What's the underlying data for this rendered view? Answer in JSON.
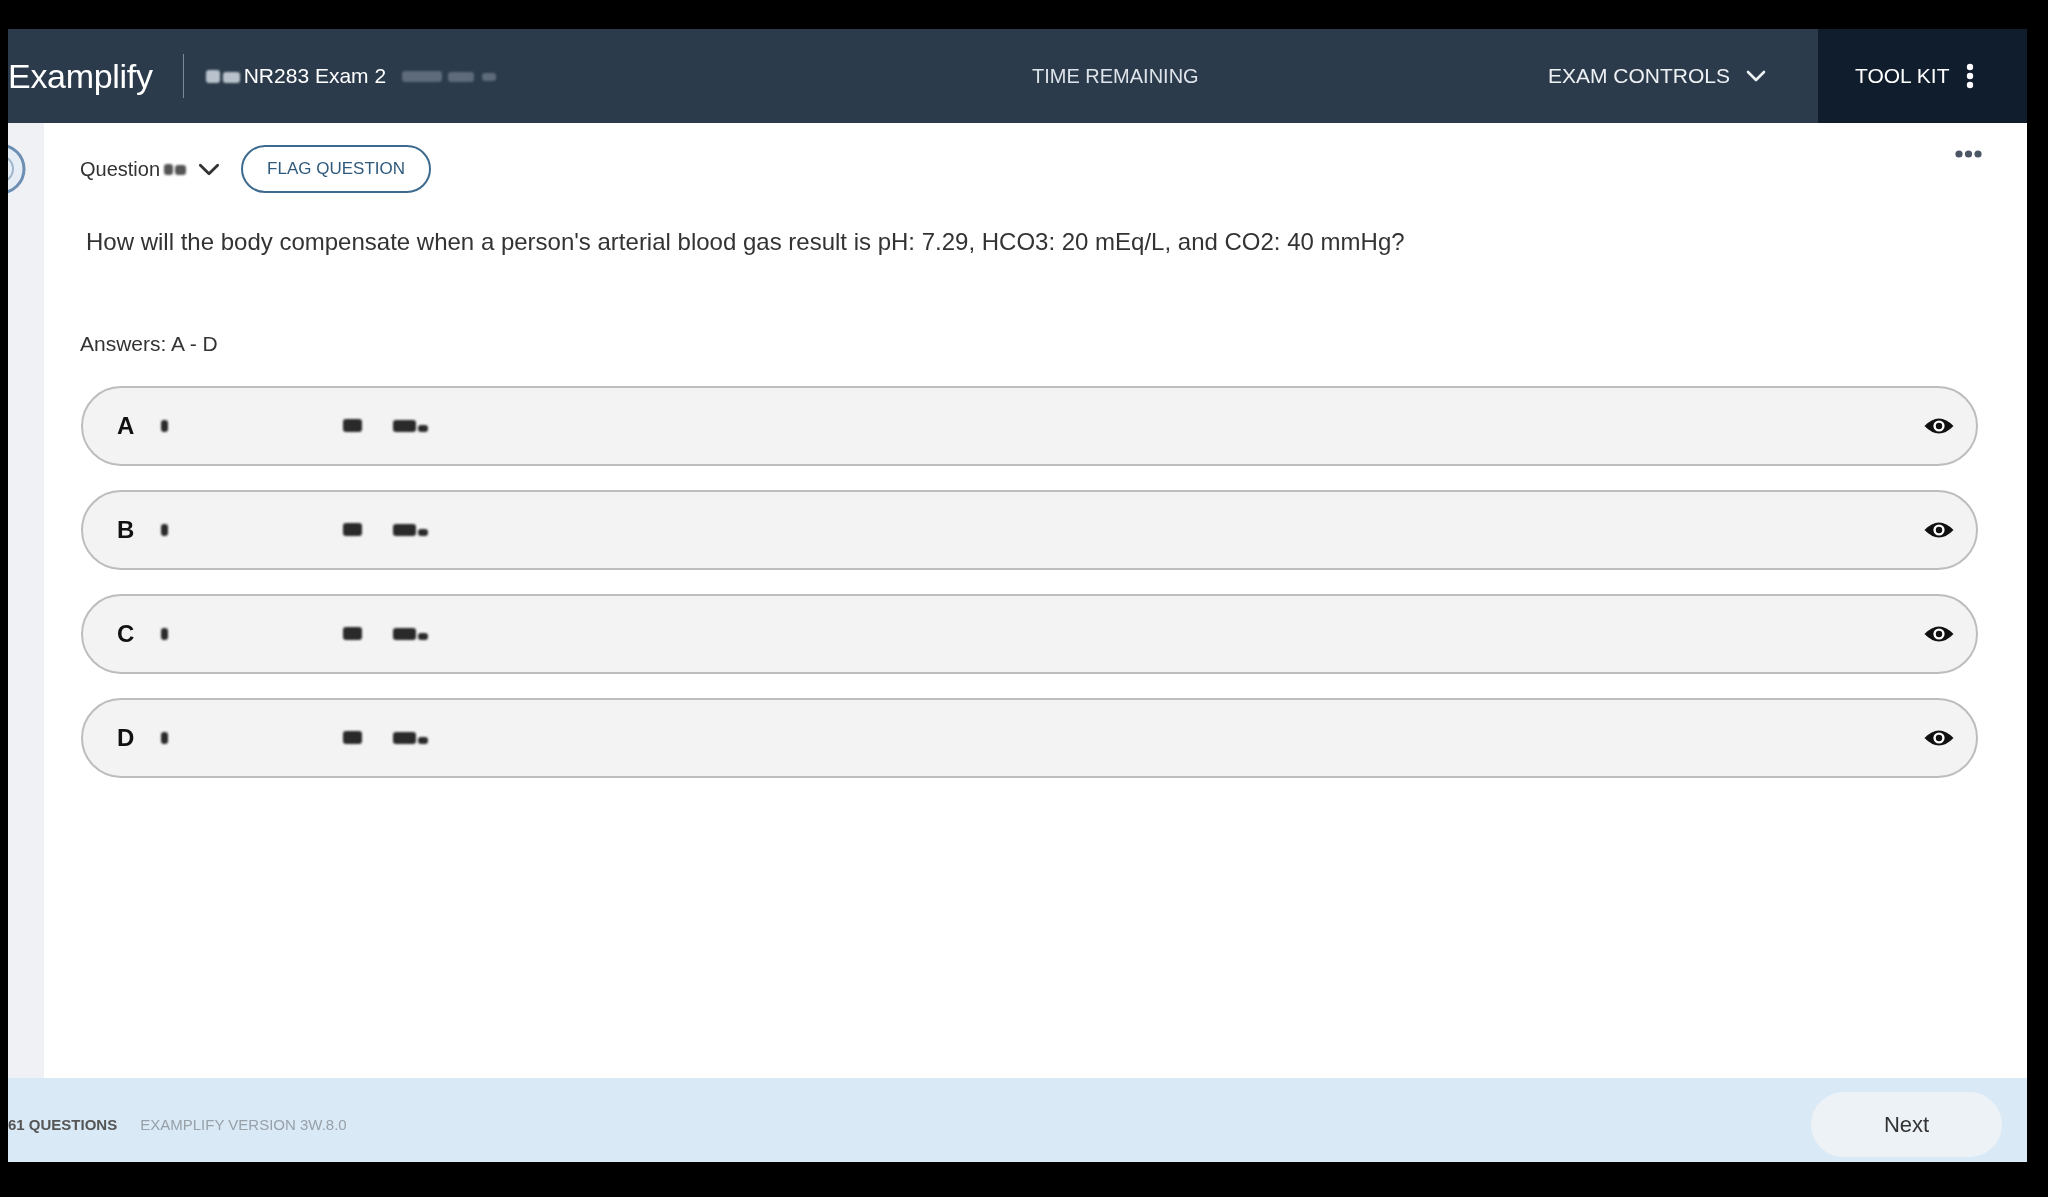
{
  "header": {
    "logo": "Examplify",
    "exam_title": "NR283 Exam 2",
    "timer_label": "TIME REMAINING",
    "exam_controls": "EXAM CONTROLS",
    "tool_kit": "TOOL KIT"
  },
  "question": {
    "label": "Question",
    "flag_button": "FLAG QUESTION",
    "text": "How will the body compensate when a person's arterial blood gas result is pH: 7.29, HCO3: 20 mEq/L, and CO2: 40 mmHg?",
    "answers_label": "Answers: A - D"
  },
  "answers": [
    {
      "letter": "A",
      "selected": false
    },
    {
      "letter": "B",
      "selected": false
    },
    {
      "letter": "C",
      "selected": false
    },
    {
      "letter": "D",
      "selected": false
    }
  ],
  "footer": {
    "question_count": "61 QUESTIONS",
    "version": "EXAMPLIFY VERSION 3W.8.0",
    "next_button": "Next"
  }
}
